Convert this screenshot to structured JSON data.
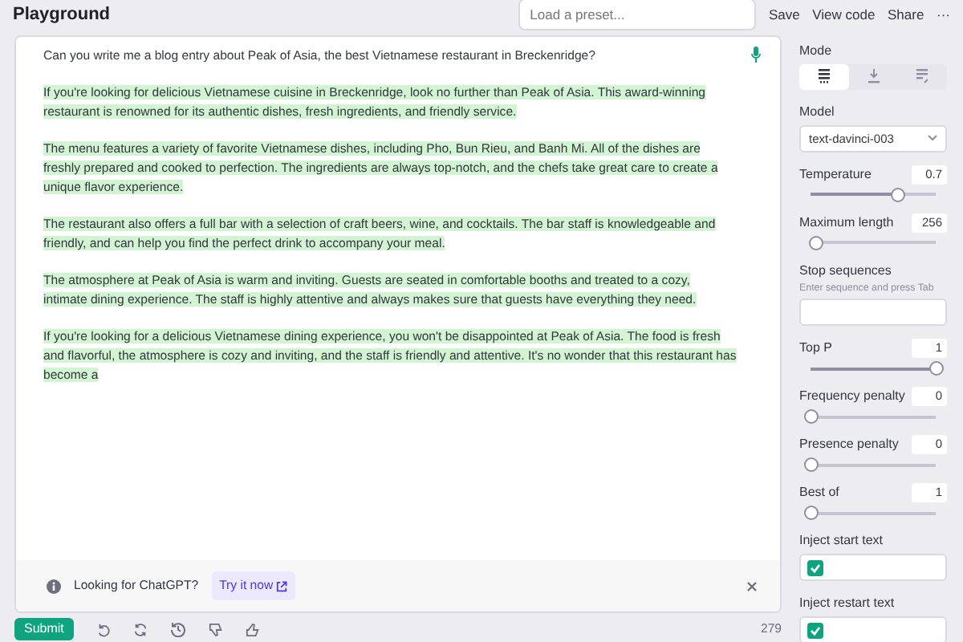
{
  "header": {
    "title": "Playground",
    "preset": {
      "placeholder": "Load a preset..."
    },
    "actions": [
      "Save",
      "View code",
      "Share",
      "···"
    ]
  },
  "editor": {
    "paragraphs": [
      {
        "text": "Can you write me a blog entry about Peak of Asia, the best Vietnamese restaurant in Breckenridge?",
        "highlighted": false
      },
      {
        "text": "If you're looking for delicious Vietnamese cuisine in Breckenridge, look no further than Peak of Asia. This award-winning restaurant is renowned for its authentic dishes, fresh ingredients, and friendly service.",
        "highlighted": true
      },
      {
        "text": "The menu features a variety of favorite Vietnamese dishes, including Pho, Bun Rieu, and Banh Mi. All of the dishes are freshly prepared and cooked to perfection. The ingredients are always top-notch, and the chefs take great care to create a unique flavor experience.",
        "highlighted": true
      },
      {
        "text": "The restaurant also offers a full bar with a selection of craft beers, wine, and cocktails. The bar staff is knowledgeable and friendly, and can help you find the perfect drink to accompany your meal.",
        "highlighted": true
      },
      {
        "text": "The atmosphere at Peak of Asia is warm and inviting. Guests are seated in comfortable booths and treated to a cozy, intimate dining experience. The staff is highly attentive and always makes sure that guests have everything they need.",
        "highlighted": true
      },
      {
        "text": "If you're looking for a delicious Vietnamese dining experience, you won't be disappointed at Peak of Asia. The food is fresh and flavorful, the atmosphere is cozy and inviting, and the staff is friendly and attentive. It's no wonder that this restaurant has become a",
        "highlighted": true
      }
    ],
    "banner": {
      "text": "Looking for ChatGPT?",
      "link": "Try it now"
    }
  },
  "toolbar": {
    "submit": "Submit",
    "token_count": "279"
  },
  "sidebar": {
    "mode": {
      "label": "Mode",
      "tabs": [
        {
          "selected": true
        },
        {
          "selected": false
        },
        {
          "selected": false
        }
      ]
    },
    "model": {
      "label": "Model",
      "value": "text-davinci-003"
    },
    "params": [
      {
        "kind": "slider",
        "label": "Temperature",
        "value": "0.7",
        "level": 0.7
      },
      {
        "kind": "slider",
        "label": "Maximum length",
        "value": "256",
        "level": 0.05
      },
      {
        "kind": "input",
        "label": "Stop sequences",
        "placeholder": "Enter sequence and press Tab"
      },
      {
        "kind": "slider",
        "label": "Top P",
        "value": "1",
        "level": 1
      },
      {
        "kind": "slider",
        "label": "Frequency penalty",
        "value": "0",
        "level": 0
      },
      {
        "kind": "slider",
        "label": "Presence penalty",
        "value": "0",
        "level": 0
      },
      {
        "kind": "slider",
        "label": "Best of",
        "value": "1",
        "level": 0
      },
      {
        "kind": "checkbox",
        "label": "Inject start text",
        "checked": true
      },
      {
        "kind": "checkbox",
        "label": "Inject restart text",
        "checked": true
      }
    ]
  }
}
